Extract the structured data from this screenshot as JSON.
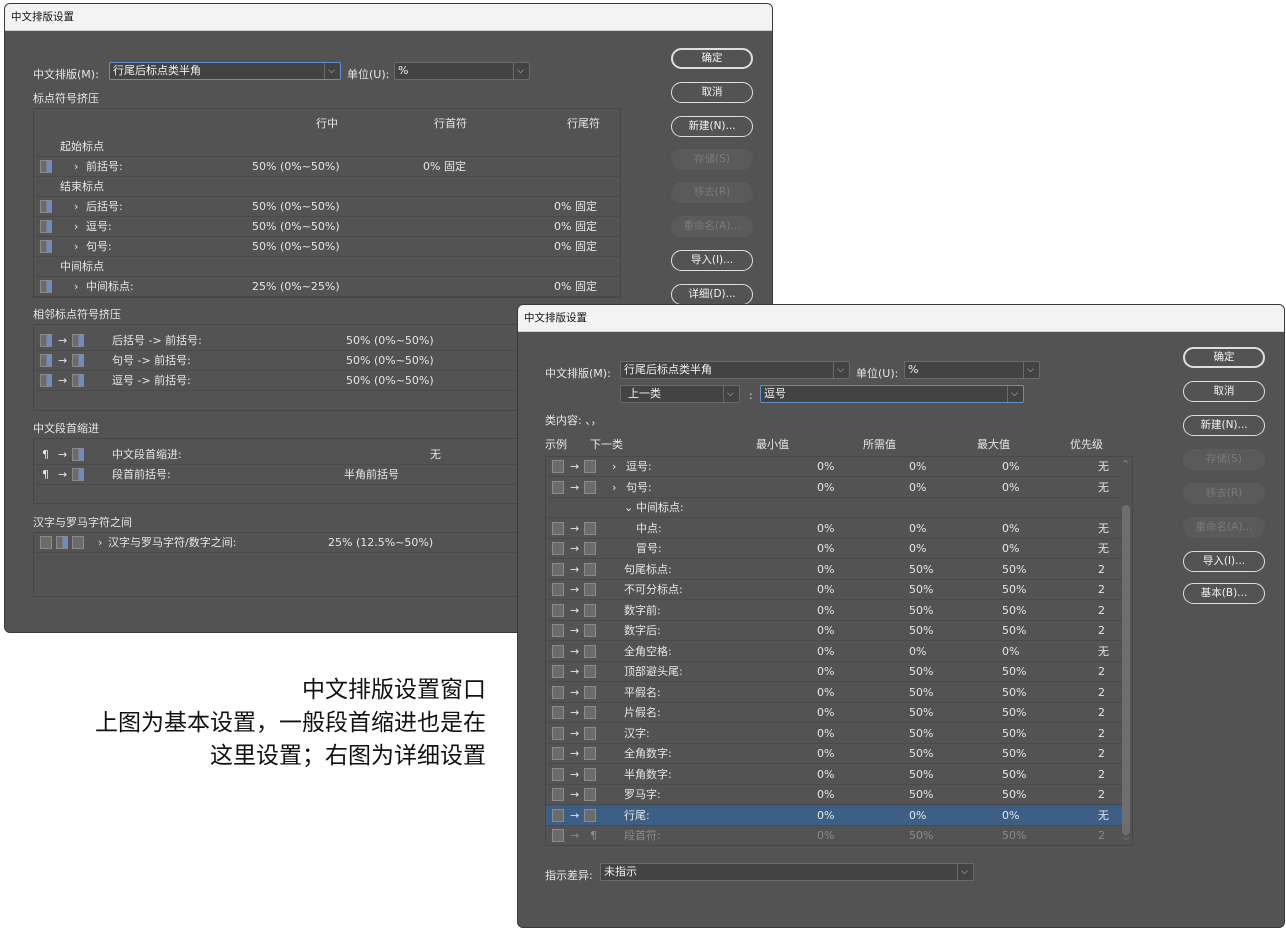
{
  "win1": {
    "title": "中文排版设置",
    "label_cjk": "中文排版(M):",
    "cjk_value": "行尾后标点类半角",
    "label_unit": "单位(U):",
    "unit_value": "%",
    "section1": "标点符号挤压",
    "headers": [
      "行中",
      "行首符",
      "行尾符"
    ],
    "rows": [
      {
        "kind": "group",
        "label": "起始标点"
      },
      {
        "kind": "item",
        "label": "前括号:",
        "mid": "50% (0%~50%)",
        "start": "0% 固定",
        "end": ""
      },
      {
        "kind": "group",
        "label": "结束标点"
      },
      {
        "kind": "item",
        "label": "后括号:",
        "mid": "50% (0%~50%)",
        "start": "",
        "end": "0% 固定"
      },
      {
        "kind": "item",
        "label": "逗号:",
        "mid": "50% (0%~50%)",
        "start": "",
        "end": "0% 固定"
      },
      {
        "kind": "item",
        "label": "句号:",
        "mid": "50% (0%~50%)",
        "start": "",
        "end": "0% 固定"
      },
      {
        "kind": "group",
        "label": "中间标点"
      },
      {
        "kind": "item",
        "label": "中间标点:",
        "mid": "25% (0%~25%)",
        "start": "",
        "end": "0% 固定"
      }
    ],
    "section2": "相邻标点符号挤压",
    "adjacent": [
      {
        "label": "后括号 -> 前括号:",
        "value": "50% (0%~50%)"
      },
      {
        "label": "句号 -> 前括号:",
        "value": "50% (0%~50%)"
      },
      {
        "label": "逗号 -> 前括号:",
        "value": "50% (0%~50%)"
      }
    ],
    "section3": "中文段首缩进",
    "indent": [
      {
        "sym": "¶",
        "label": "中文段首缩进:",
        "value": "无"
      },
      {
        "sym": "¶",
        "label": "段首前括号:",
        "value": "半角前括号"
      }
    ],
    "section4": "汉字与罗马字符之间",
    "roman": {
      "label": "汉字与罗马字符/数字之间:",
      "value": "25% (12.5%~50%)"
    },
    "buttons": [
      "确定",
      "取消",
      "新建(N)...",
      "存储(S)",
      "移去(R)",
      "重命名(A)...",
      "导入(I)...",
      "详细(D)..."
    ]
  },
  "win2": {
    "title": "中文排版设置",
    "label_cjk": "中文排版(M):",
    "cjk_value": "行尾后标点类半角",
    "label_unit": "单位(U):",
    "unit_value": "%",
    "prev_class": "上一类",
    "colon": ":",
    "next_class": "逗号",
    "content_label": "类内容: 、，",
    "headers": [
      "示例",
      "下一类",
      "最小值",
      "所需值",
      "最大值",
      "优先级"
    ],
    "rows": [
      {
        "label": "逗号:",
        "min": "0%",
        "des": "0%",
        "max": "0%",
        "pri": "无",
        "caret": "›"
      },
      {
        "label": "句号:",
        "min": "0%",
        "des": "0%",
        "max": "0%",
        "pri": "无",
        "caret": "›"
      },
      {
        "label": "中间标点:",
        "min": "",
        "des": "",
        "max": "",
        "pri": "",
        "caret": "⌄",
        "group": true
      },
      {
        "label": "中点:",
        "min": "0%",
        "des": "0%",
        "max": "0%",
        "pri": "无",
        "indent": true
      },
      {
        "label": "冒号:",
        "min": "0%",
        "des": "0%",
        "max": "0%",
        "pri": "无",
        "indent": true
      },
      {
        "label": "句尾标点:",
        "min": "0%",
        "des": "50%",
        "max": "50%",
        "pri": "2"
      },
      {
        "label": "不可分标点:",
        "min": "0%",
        "des": "50%",
        "max": "50%",
        "pri": "2"
      },
      {
        "label": "数字前:",
        "min": "0%",
        "des": "50%",
        "max": "50%",
        "pri": "2"
      },
      {
        "label": "数字后:",
        "min": "0%",
        "des": "50%",
        "max": "50%",
        "pri": "2"
      },
      {
        "label": "全角空格:",
        "min": "0%",
        "des": "0%",
        "max": "0%",
        "pri": "无"
      },
      {
        "label": "顶部避头尾:",
        "min": "0%",
        "des": "50%",
        "max": "50%",
        "pri": "2"
      },
      {
        "label": "平假名:",
        "min": "0%",
        "des": "50%",
        "max": "50%",
        "pri": "2"
      },
      {
        "label": "片假名:",
        "min": "0%",
        "des": "50%",
        "max": "50%",
        "pri": "2"
      },
      {
        "label": "汉字:",
        "min": "0%",
        "des": "50%",
        "max": "50%",
        "pri": "2"
      },
      {
        "label": "全角数字:",
        "min": "0%",
        "des": "50%",
        "max": "50%",
        "pri": "2"
      },
      {
        "label": "半角数字:",
        "min": "0%",
        "des": "50%",
        "max": "50%",
        "pri": "2"
      },
      {
        "label": "罗马字:",
        "min": "0%",
        "des": "50%",
        "max": "50%",
        "pri": "2"
      },
      {
        "label": "行尾:",
        "min": "0%",
        "des": "0%",
        "max": "0%",
        "pri": "无",
        "selected": true
      },
      {
        "label": "段首符:",
        "min": "0%",
        "des": "50%",
        "max": "50%",
        "pri": "2",
        "dim": true,
        "sym": "¶"
      }
    ],
    "diff_label": "指示差异:",
    "diff_value": "未指示",
    "buttons": [
      "确定",
      "取消",
      "新建(N)...",
      "存储(S)",
      "移去(R)",
      "重命名(A)...",
      "导入(I)...",
      "基本(B)..."
    ]
  },
  "caption": [
    "中文排版设置窗口",
    "上图为基本设置，一般段首缩进也是在",
    "这里设置；右图为详细设置"
  ],
  "arrow": "→"
}
